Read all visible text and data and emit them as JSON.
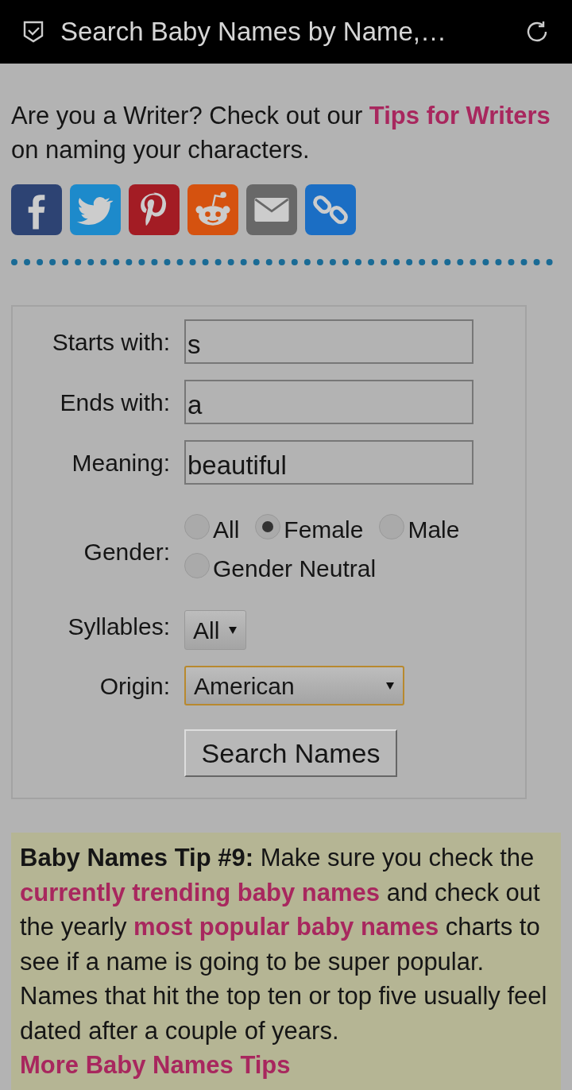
{
  "header": {
    "title": "Search Baby Names by Name,…"
  },
  "intro": [
    {
      "kind": "text",
      "text": "Are you a Writer? Check out our "
    },
    {
      "kind": "link",
      "text": "Tips for Writers"
    },
    {
      "kind": "text",
      "text": " on naming your characters."
    }
  ],
  "share_buttons": [
    {
      "kind": "facebook",
      "color": "#2d4373"
    },
    {
      "kind": "twitter",
      "color": "#1d8acb"
    },
    {
      "kind": "pinterest",
      "color": "#a31c24"
    },
    {
      "kind": "reddit",
      "color": "#d5520f"
    },
    {
      "kind": "email",
      "color": "#686868"
    },
    {
      "kind": "link",
      "color": "#1b6ec4"
    }
  ],
  "form": {
    "starts_with": {
      "label": "Starts with:",
      "value": "s"
    },
    "ends_with": {
      "label": "Ends with:",
      "value": "a"
    },
    "meaning": {
      "label": "Meaning:",
      "value": "beautiful"
    },
    "gender": {
      "label": "Gender:",
      "options": [
        {
          "label": "All",
          "selected": false
        },
        {
          "label": "Female",
          "selected": true
        },
        {
          "label": "Male",
          "selected": false
        },
        {
          "label": "Gender Neutral",
          "selected": false
        }
      ]
    },
    "syllables": {
      "label": "Syllables:",
      "value": "All"
    },
    "origin": {
      "label": "Origin:",
      "value": "American",
      "focused": true
    },
    "submit": "Search Names"
  },
  "tip": [
    {
      "kind": "bold",
      "text": "Baby Names Tip #9:"
    },
    {
      "kind": "text",
      "text": " Make sure you check the "
    },
    {
      "kind": "link",
      "text": "currently trending baby names"
    },
    {
      "kind": "text",
      "text": " and check out the yearly "
    },
    {
      "kind": "link",
      "text": "most popular baby names"
    },
    {
      "kind": "text",
      "text": " charts to see if a name is going to be super popular. Names that hit the top ten or top five usually feel dated after a couple of years. "
    },
    {
      "kind": "link",
      "text": "More Baby Names Tips"
    }
  ]
}
